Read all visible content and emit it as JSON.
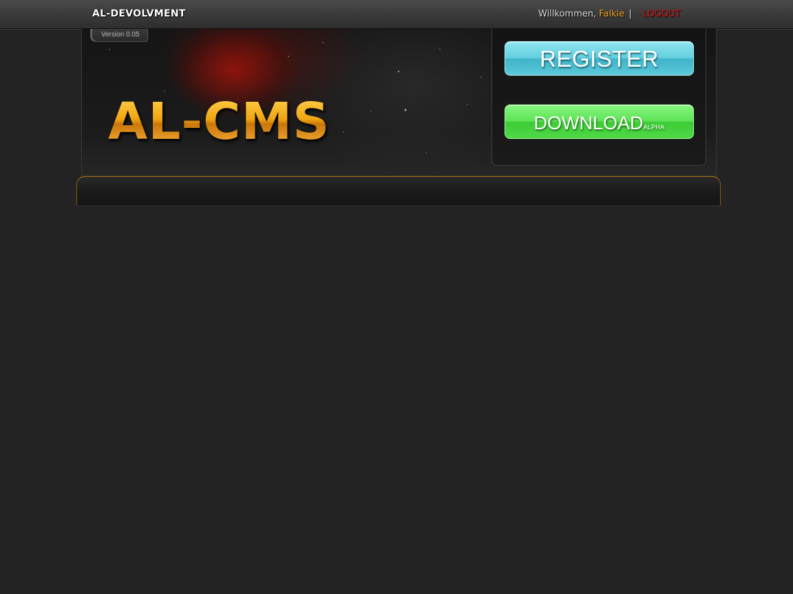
{
  "topbar": {
    "brand": "AL-DEVOLVMENT",
    "welcome": "Willkommen,",
    "username": "Falkie",
    "separator": "|",
    "logout": "LOGOUT"
  },
  "header": {
    "version": "Version 0.05",
    "logo": "AL-CMS"
  },
  "panel": {
    "register_label": "REGISTER",
    "download_label": "DOWNLOAD",
    "download_tag": "ALPHA"
  },
  "colors": {
    "username": "#f5a623",
    "logout": "#e01010",
    "register": "#63cfe0",
    "download": "#5fe357",
    "logo": "#f0a512"
  }
}
